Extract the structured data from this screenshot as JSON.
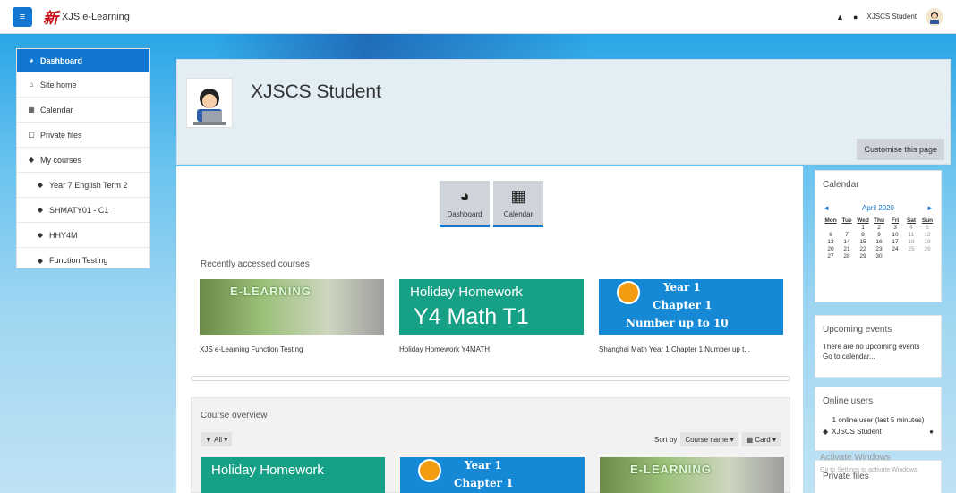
{
  "navbar": {
    "menu_icon": "hamburger-icon",
    "logo_text": "新",
    "site_name": "XJS e-Learning",
    "bell_icon": "bell-icon",
    "chat_icon": "chat-icon",
    "user_name": "XJSCS Student"
  },
  "drawer": {
    "items": [
      {
        "label": "Dashboard",
        "icon": "dashboard-icon",
        "active": true
      },
      {
        "label": "Site home",
        "icon": "home-icon"
      },
      {
        "label": "Calendar",
        "icon": "calendar-icon"
      },
      {
        "label": "Private files",
        "icon": "file-icon"
      },
      {
        "label": "My courses",
        "icon": "graduation-cap-icon"
      },
      {
        "label": "Year 7 English Term 2",
        "icon": "graduation-cap-icon"
      },
      {
        "label": "SHMATY01 - C1",
        "icon": "graduation-cap-icon"
      },
      {
        "label": "HHY4M",
        "icon": "graduation-cap-icon"
      },
      {
        "label": "Function Testing",
        "icon": "graduation-cap-icon"
      }
    ]
  },
  "header": {
    "user_name": "XJSCS Student",
    "customise_label": "Customise this page"
  },
  "shortcuts": {
    "dashboard_label": "Dashboard",
    "calendar_label": "Calendar"
  },
  "recent": {
    "title": "Recently accessed courses",
    "courses": [
      {
        "name": "XJS e-Learning Function Testing",
        "image_text": "E-LEARNING"
      },
      {
        "name": "Holiday Homework Y4MATH",
        "image_line1": "Holiday Homework",
        "image_line2": "Y4 Math T1"
      },
      {
        "name": "Shanghai Math Year 1 Chapter 1 Number up t...",
        "image_line1": "Year 1",
        "image_line2": "Chapter 1",
        "image_line3": "Number up to 10"
      }
    ]
  },
  "overview": {
    "title": "Course overview",
    "filter_label": "All",
    "sort_prefix": "Sort by",
    "sort_value": "Course name",
    "view_label": "Card",
    "cards": [
      {
        "line1": "Holiday Homework"
      },
      {
        "line1": "Year 1",
        "line2": "Chapter 1"
      },
      {
        "image_text": "E-LEARNING"
      }
    ]
  },
  "calendar": {
    "title": "Calendar",
    "month": "April 2020",
    "prev": "◄",
    "next": "►",
    "days": [
      "Mon",
      "Tue",
      "Wed",
      "Thu",
      "Fri",
      "Sat",
      "Sun"
    ],
    "weeks": [
      [
        "",
        "",
        "1",
        "2",
        "3",
        "4",
        "5"
      ],
      [
        "6",
        "7",
        "8",
        "9",
        "10",
        "11",
        "12"
      ],
      [
        "13",
        "14",
        "15",
        "16",
        "17",
        "18",
        "19"
      ],
      [
        "20",
        "21",
        "22",
        "23",
        "24",
        "25",
        "26"
      ],
      [
        "27",
        "28",
        "29",
        "30",
        "",
        "",
        ""
      ]
    ]
  },
  "upcoming": {
    "title": "Upcoming events",
    "text": "There are no upcoming events",
    "link": "Go to calendar..."
  },
  "online": {
    "title": "Online users",
    "summary": "1 online user (last 5 minutes)",
    "user": "XJSCS Student"
  },
  "private_files": {
    "title": "Private files"
  },
  "watermark": {
    "line1": "Activate Windows",
    "line2": "Go to Settings to activate Windows."
  },
  "colors": {
    "primary": "#1177d1",
    "math_card": "#16a085",
    "year_card": "#1689d6"
  }
}
